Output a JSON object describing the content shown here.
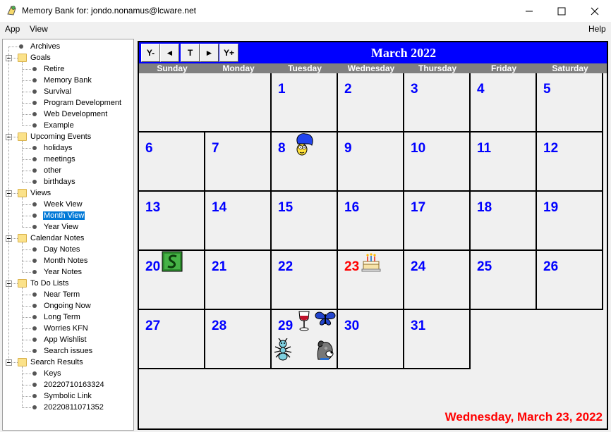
{
  "window": {
    "title": "Memory Bank for: jondo.nonamus@lcware.net"
  },
  "menu": {
    "app": "App",
    "view": "View",
    "help": "Help"
  },
  "tree": {
    "groups": [
      {
        "label": "Archives",
        "items": []
      },
      {
        "label": "Goals",
        "items": [
          "Retire",
          "Memory Bank",
          "Survival",
          "Program Development",
          "Web Development",
          "Example"
        ]
      },
      {
        "label": "Upcoming Events",
        "items": [
          "holidays",
          "meetings",
          "other",
          "birthdays"
        ]
      },
      {
        "label": "Views",
        "items": [
          "Week View",
          "Month View",
          "Year View"
        ]
      },
      {
        "label": "Calendar Notes",
        "items": [
          "Day Notes",
          "Month Notes",
          "Year Notes"
        ]
      },
      {
        "label": "To Do Lists",
        "items": [
          "Near Term",
          "Ongoing Now",
          "Long Term",
          "Worries KFN",
          "App Wishlist",
          "Search issues"
        ]
      },
      {
        "label": "Search Results",
        "items": [
          "Keys",
          "20220710163324",
          "Symbolic Link",
          "20220811071352"
        ]
      }
    ],
    "selected": "Month View"
  },
  "calendar": {
    "nav": {
      "prev_year": "Y-",
      "prev_month": "◄",
      "today": "T",
      "next_month": "►",
      "next_year": "Y+"
    },
    "title": "March 2022",
    "weekdays": [
      "Sunday",
      "Monday",
      "Tuesday",
      "Wednesday",
      "Thursday",
      "Friday",
      "Saturday"
    ],
    "days": [
      "1",
      "2",
      "3",
      "4",
      "5",
      "6",
      "7",
      "8",
      "9",
      "10",
      "11",
      "12",
      "13",
      "14",
      "15",
      "16",
      "17",
      "18",
      "19",
      "20",
      "21",
      "22",
      "23",
      "24",
      "25",
      "26",
      "27",
      "28",
      "29",
      "30",
      "31"
    ],
    "first_weekday": 2,
    "today": "23",
    "stickers": {
      "8": [
        "marge-simpson-icon"
      ],
      "20": [
        "green-s-icon"
      ],
      "23": [
        "birthday-cake-icon"
      ],
      "29": [
        "wine-glass-icon",
        "butterfly-icon",
        "ant-icon",
        "dog-icon"
      ]
    },
    "colors": {
      "header": "#0000ff",
      "daynum": "#0000ff",
      "today": "#ff0000",
      "dow_bar": "#808080"
    },
    "selected_date_text": "Wednesday, March 23, 2022"
  }
}
